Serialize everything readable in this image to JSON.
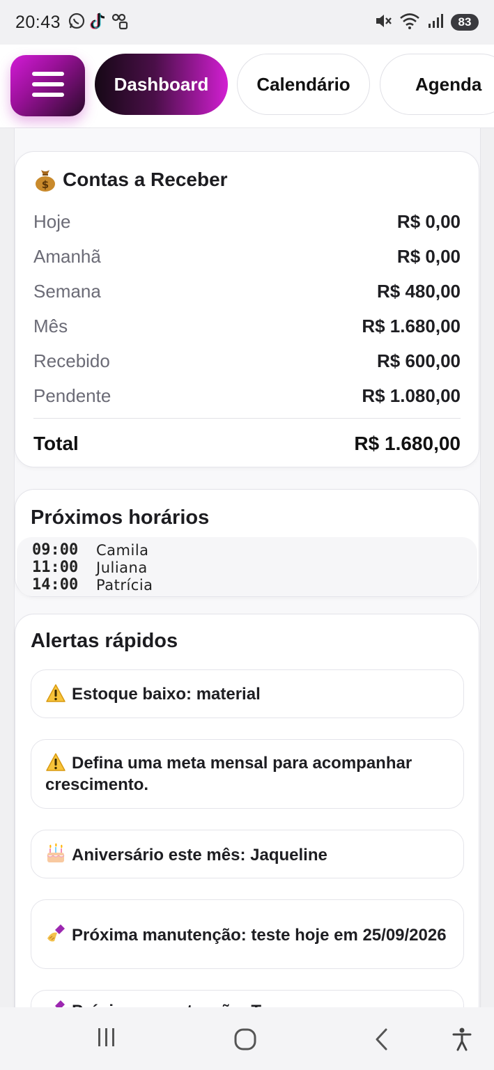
{
  "status_bar": {
    "time": "20:43",
    "battery": "83",
    "left_icons": [
      "whatsapp-icon",
      "tiktok-icon",
      "link-icon"
    ],
    "right_icons": [
      "mute-icon",
      "wifi-icon",
      "signal-icon",
      "battery-icon"
    ]
  },
  "nav": {
    "menu_icon": "hamburger-menu-icon",
    "tabs": [
      {
        "label": "Dashboard",
        "active": true
      },
      {
        "label": "Calendário",
        "active": false
      },
      {
        "label": "Agenda",
        "active": false
      }
    ]
  },
  "contas": {
    "icon": "money-bag-icon",
    "title": "Contas a Receber",
    "rows": [
      {
        "label": "Hoje",
        "value": "R$ 0,00"
      },
      {
        "label": "Amanhã",
        "value": "R$ 0,00"
      },
      {
        "label": "Semana",
        "value": "R$ 480,00"
      },
      {
        "label": "Mês",
        "value": "R$ 1.680,00"
      },
      {
        "label": "Recebido",
        "value": "R$ 600,00"
      },
      {
        "label": "Pendente",
        "value": "R$ 1.080,00"
      }
    ],
    "total_label": "Total",
    "total_value": "R$ 1.680,00"
  },
  "proximos": {
    "title": "Próximos horários",
    "items": [
      {
        "time": "09:00",
        "name": "Camila"
      },
      {
        "time": "11:00",
        "name": "Juliana"
      },
      {
        "time": "14:00",
        "name": "Patrícia"
      }
    ]
  },
  "alertas": {
    "title": "Alertas rápidos",
    "items": [
      {
        "icon": "warning-icon",
        "text": "Estoque baixo: material"
      },
      {
        "icon": "warning-icon",
        "text": "Defina uma meta mensal para acompanhar crescimento."
      },
      {
        "icon": "birthday-cake-icon",
        "text": "Aniversário este mês: Jaqueline"
      },
      {
        "icon": "nail-polish-icon",
        "text": "Próxima manutenção: teste hoje em 25/09/2026"
      },
      {
        "icon": "nail-polish-icon",
        "text": "Próxima manutenção: Tes..."
      }
    ]
  },
  "colors": {
    "accent": "#d21fd2",
    "accent_dark": "#160816"
  }
}
